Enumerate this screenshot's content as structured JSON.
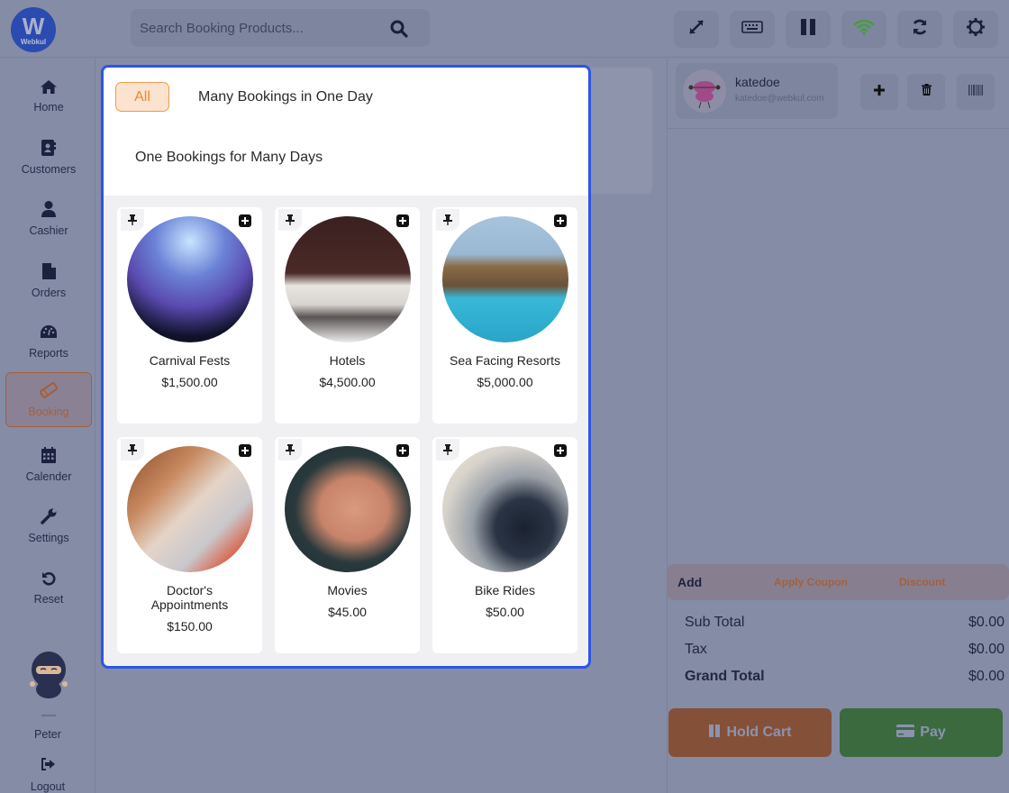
{
  "brand": {
    "logo_letter": "W",
    "logo_text": "Webkul"
  },
  "search": {
    "placeholder": "Search Booking Products..."
  },
  "toolbar": {
    "icons": [
      "expand-icon",
      "keyboard-icon",
      "pause-icon",
      "wifi-icon",
      "sync-icon",
      "settings-icon"
    ],
    "wifi_color": "#4a9a45"
  },
  "sidebar": {
    "items": [
      {
        "label": "Home",
        "icon": "home-icon"
      },
      {
        "label": "Customers",
        "icon": "address-book-icon"
      },
      {
        "label": "Cashier",
        "icon": "user-icon"
      },
      {
        "label": "Orders",
        "icon": "file-icon"
      },
      {
        "label": "Reports",
        "icon": "gauge-icon"
      },
      {
        "label": "Booking",
        "icon": "ticket-icon",
        "active": true
      },
      {
        "label": "Calender",
        "icon": "calendar-icon"
      },
      {
        "label": "Settings",
        "icon": "wrench-icon"
      },
      {
        "label": "Reset",
        "icon": "undo-icon"
      }
    ],
    "user_name": "Peter",
    "logout_label": "Logout"
  },
  "booking_modal": {
    "tabs": [
      {
        "label": "All",
        "active": true
      },
      {
        "label": "Many Bookings in One Day"
      },
      {
        "label": "One Bookings for Many Days"
      }
    ],
    "products": [
      {
        "name": "Carnival Fests",
        "price": "$1,500.00"
      },
      {
        "name": "Hotels",
        "price": "$4,500.00"
      },
      {
        "name": "Sea Facing Resorts",
        "price": "$5,000.00"
      },
      {
        "name": "Doctor's Appointments",
        "price": "$150.00"
      },
      {
        "name": "Movies",
        "price": "$45.00"
      },
      {
        "name": "Bike Rides",
        "price": "$50.00"
      }
    ]
  },
  "customer": {
    "name": "katedoe",
    "email": "katedoe@webkul.com"
  },
  "cart": {
    "actions": {
      "add": "Add",
      "coupon": "Apply Coupon",
      "discount": "Discount"
    },
    "totals": [
      {
        "label": "Sub Total",
        "value": "$0.00"
      },
      {
        "label": "Tax",
        "value": "$0.00"
      },
      {
        "label": "Grand Total",
        "value": "$0.00",
        "bold": true
      }
    ],
    "hold_label": "Hold Cart",
    "pay_label": "Pay"
  },
  "colors": {
    "accent": "#ee8a2a",
    "modal_border": "#2d55e6",
    "hold": "#855038",
    "pay": "#3b6a3e"
  }
}
